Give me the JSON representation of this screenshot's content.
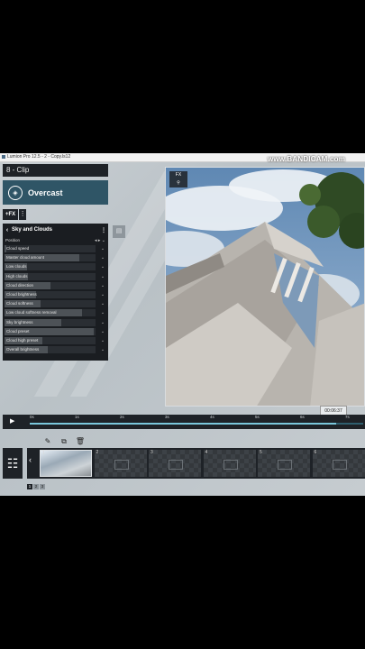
{
  "window": {
    "title": "Lumion Pro 12.5 - 2 - Copy.ls12"
  },
  "watermark": "www.BANDICAM.com",
  "clip_panel": {
    "title": "8 - Clip",
    "preset_label": "Overcast",
    "add_fx_label": "+FX",
    "menu_glyph": "⋮"
  },
  "effect": {
    "title": "Sky and Clouds",
    "position_label": "Position",
    "sliders": [
      {
        "label": "Cloud speed",
        "value": 0.02
      },
      {
        "label": "Master cloud amount",
        "value": 0.82
      },
      {
        "label": "Low clouds",
        "value": 0.25
      },
      {
        "label": "High clouds",
        "value": 0.26
      },
      {
        "label": "Cloud direction",
        "value": 0.5
      },
      {
        "label": "Cloud brightness",
        "value": 0.35
      },
      {
        "label": "Cloud softness",
        "value": 0.4
      },
      {
        "label": "Low cloud softness removal",
        "value": 0.85
      },
      {
        "label": "Sky brightness",
        "value": 0.62
      },
      {
        "label": "Cloud preset",
        "value": 0.98
      },
      {
        "label": "Cloud high preset",
        "value": 0.42
      },
      {
        "label": "Overall brightness",
        "value": 0.48
      }
    ]
  },
  "viewport": {
    "fx_badge": "FX"
  },
  "timeline": {
    "ticks": [
      "0s",
      "1s",
      "2s",
      "3s",
      "4s",
      "5s",
      "6s",
      "7s"
    ],
    "current_time": "00:06:37",
    "progress": 0.92
  },
  "clips": {
    "numbers": [
      "1",
      "2",
      "3",
      "4",
      "5",
      "6"
    ]
  },
  "pages": [
    "1",
    "2",
    "3"
  ]
}
